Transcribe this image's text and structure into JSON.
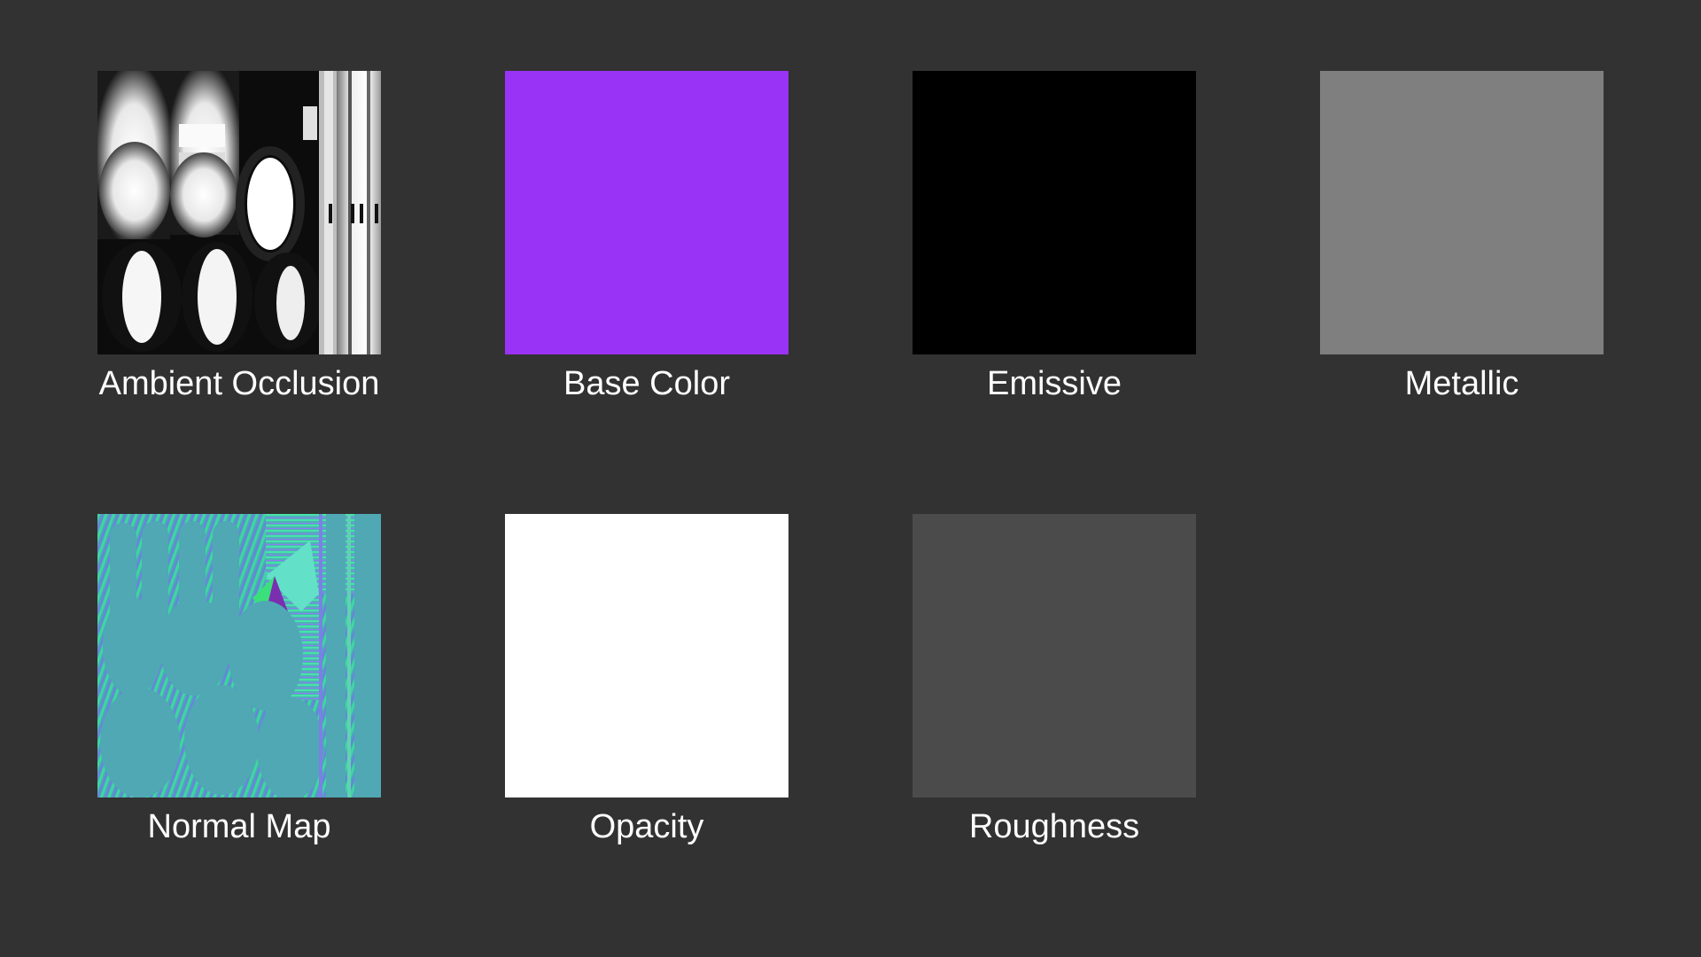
{
  "textures": {
    "ambient_occlusion": {
      "label": "Ambient Occlusion",
      "kind": "ao-map-image"
    },
    "base_color": {
      "label": "Base Color",
      "color": "#9933F5"
    },
    "emissive": {
      "label": "Emissive",
      "color": "#000000"
    },
    "metallic": {
      "label": "Metallic",
      "color": "#7F7F7F"
    },
    "normal_map": {
      "label": "Normal Map",
      "kind": "normal-map-image"
    },
    "opacity": {
      "label": "Opacity",
      "color": "#FFFFFF"
    },
    "roughness": {
      "label": "Roughness",
      "color": "#4B4B4B"
    }
  },
  "colors": {
    "background": "#323232",
    "label_text": "#FFFFFF",
    "normal_map_base": "#4FA8B4",
    "normal_map_accent_green": "#3BE0A0",
    "normal_map_accent_purple": "#7A2FB0"
  }
}
